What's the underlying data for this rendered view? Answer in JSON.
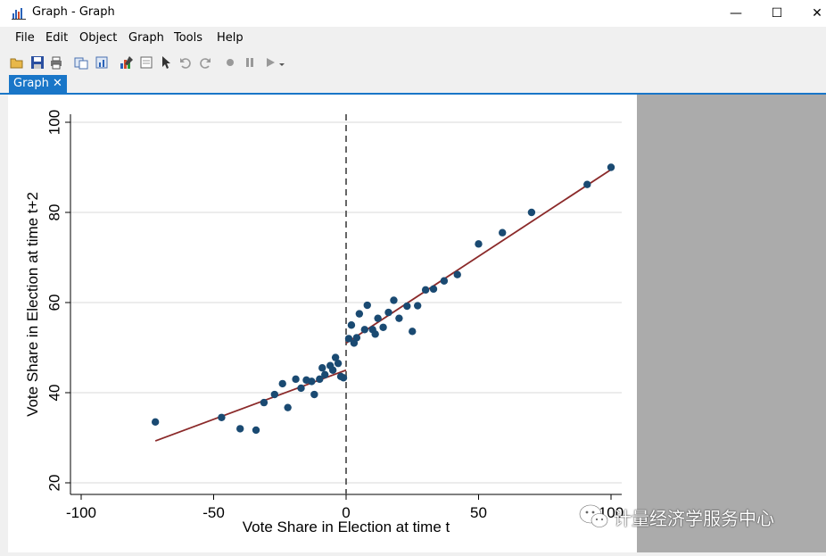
{
  "window": {
    "title": "Graph - Graph",
    "minimize": "—",
    "maximize": "☐",
    "close": "✕"
  },
  "menu": {
    "items": [
      "File",
      "Edit",
      "Object",
      "Graph",
      "Tools",
      "Help"
    ]
  },
  "toolbar": {
    "icons": [
      "open-icon",
      "save-icon",
      "print-icon",
      "copy-icon",
      "copy-graph-icon",
      "graph-editor-icon",
      "graph-window-icon",
      "pointer-icon",
      "undo-icon",
      "redo-icon",
      "record-icon",
      "pause-icon",
      "play-icon"
    ]
  },
  "tab": {
    "label": "Graph",
    "close": "✕"
  },
  "watermark": {
    "text": "计量经济学服务中心"
  },
  "chart_data": {
    "type": "scatter",
    "xlabel": "Vote Share in Election at time t",
    "ylabel": "Vote Share in Election at time t+2",
    "xlim": [
      -100,
      100
    ],
    "ylim": [
      20,
      100
    ],
    "xticks": [
      -100,
      -50,
      0,
      50,
      100
    ],
    "yticks": [
      20,
      40,
      60,
      80,
      100
    ],
    "grid": true,
    "cutoff": 0,
    "colors": {
      "points": "#1a4a72",
      "fit": "#8b2a2a",
      "cutoff": "#666666",
      "grid": "#e6e6e6"
    },
    "points": [
      [
        -72,
        33.5
      ],
      [
        -47,
        34.5
      ],
      [
        -40,
        32
      ],
      [
        -34,
        31.7
      ],
      [
        -31,
        37.8
      ],
      [
        -27,
        39.6
      ],
      [
        -24,
        42
      ],
      [
        -22,
        36.7
      ],
      [
        -19,
        43
      ],
      [
        -17,
        41
      ],
      [
        -15,
        42.8
      ],
      [
        -13,
        42.5
      ],
      [
        -12,
        39.6
      ],
      [
        -10,
        43
      ],
      [
        -9,
        45.5
      ],
      [
        -8,
        44
      ],
      [
        -6,
        46
      ],
      [
        -5,
        45
      ],
      [
        -4,
        47.8
      ],
      [
        -3,
        46.5
      ],
      [
        -2,
        43.6
      ],
      [
        -1,
        43.3
      ],
      [
        1,
        52
      ],
      [
        2,
        55
      ],
      [
        3,
        51
      ],
      [
        4,
        52.2
      ],
      [
        5,
        57.5
      ],
      [
        7,
        54
      ],
      [
        8,
        59.4
      ],
      [
        10,
        54
      ],
      [
        11,
        53
      ],
      [
        12,
        56.5
      ],
      [
        14,
        54.5
      ],
      [
        16,
        57.8
      ],
      [
        18,
        60.5
      ],
      [
        20,
        56.5
      ],
      [
        23,
        59.2
      ],
      [
        25,
        53.6
      ],
      [
        27,
        59.3
      ],
      [
        30,
        62.8
      ],
      [
        33,
        63
      ],
      [
        37,
        64.8
      ],
      [
        42,
        66.2
      ],
      [
        50,
        73
      ],
      [
        59,
        75.5
      ],
      [
        70,
        80
      ],
      [
        91,
        86.2
      ],
      [
        100,
        90
      ]
    ],
    "fit_left": [
      [
        -72,
        29.3
      ],
      [
        0,
        45
      ]
    ],
    "fit_right": [
      [
        0,
        51
      ],
      [
        100,
        89.5
      ]
    ]
  }
}
